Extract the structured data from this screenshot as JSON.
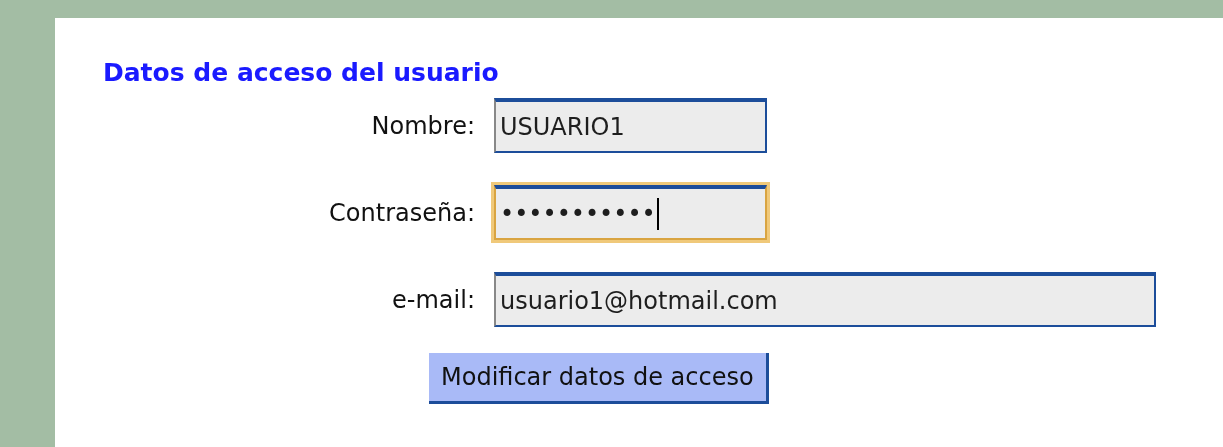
{
  "section_title": "Datos de acceso del usuario",
  "fields": [
    {
      "label": "Nombre:",
      "value": "USUARIO1",
      "focused": false
    },
    {
      "label": "Contraseña:",
      "value": "•••••••••••",
      "focused": true
    },
    {
      "label": "e-mail:",
      "value": "usuario1@hotmail.com",
      "focused": false
    }
  ],
  "submit_button": "Modificar datos de acceso"
}
